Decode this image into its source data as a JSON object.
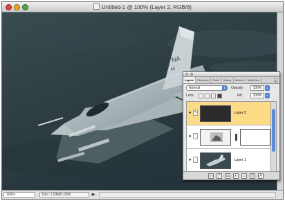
{
  "window": {
    "title": "Untitled-1 @ 100% (Layer 2, RGB/8)"
  },
  "status": {
    "zoom": "100%",
    "doc_info": "Doc: 1.03M/1.03M"
  },
  "layers_palette": {
    "tabs": [
      "Layers",
      "Channels",
      "Paths",
      "History",
      "Actions",
      "Swatches"
    ],
    "blend_mode": "Normal",
    "opacity_label": "Opacity:",
    "opacity_value": "100%",
    "lock_label": "Lock:",
    "fill_label": "Fill:",
    "fill_value": "100%",
    "layers": [
      {
        "name": "Layer 2",
        "selected": true,
        "visible": true
      },
      {
        "name": "",
        "selected": false,
        "visible": true,
        "has_mask": true
      },
      {
        "name": "Layer 1",
        "selected": false,
        "visible": true
      }
    ]
  },
  "icons": {
    "eye": "eye-icon",
    "brush": "brush-icon",
    "link": "link-icon",
    "menu": "palette-menu-icon"
  },
  "colors": {
    "selected_layer": "#fbdb86",
    "canvas": "#2f4044",
    "accent": "#4e84d3"
  }
}
